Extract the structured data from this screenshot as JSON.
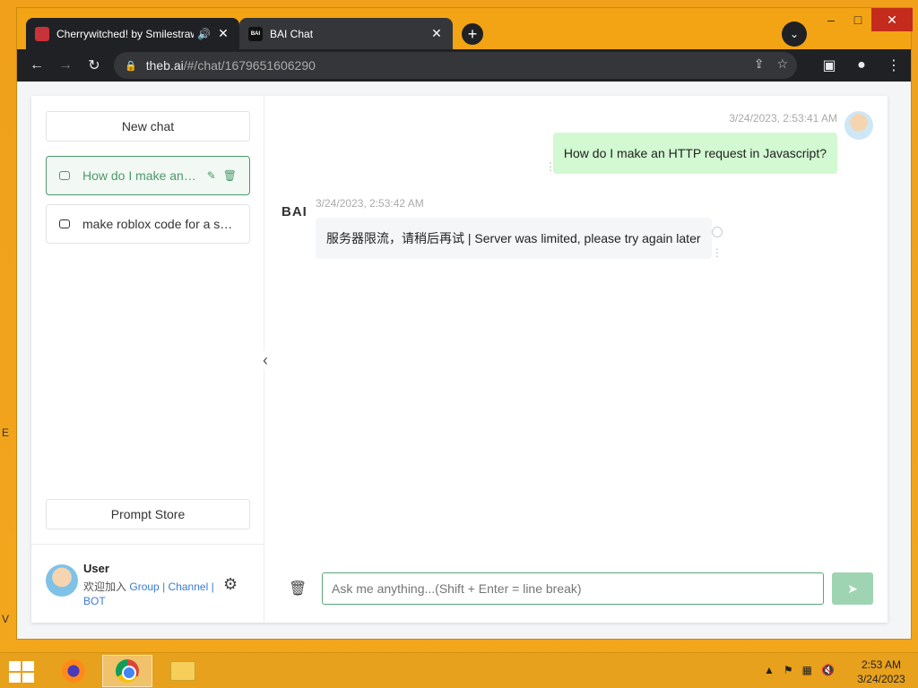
{
  "browser": {
    "tabs": [
      {
        "title": "Cherrywitched! by Smilestraw",
        "audio_icon": "speaker-icon",
        "close": "✕"
      },
      {
        "title": "BAI Chat",
        "favicon_text": "BAI",
        "close": "✕"
      }
    ],
    "new_tab": "+",
    "tab_search": "⌄",
    "window": {
      "minimize": "–",
      "maximize": "□",
      "close": "✕"
    },
    "nav": {
      "back": "←",
      "forward": "→",
      "reload": "↻"
    },
    "url_host": "theb.ai",
    "url_path": "/#/chat/1679651606290",
    "omni_icons": {
      "share": "⇪",
      "star": "☆"
    },
    "right_tools": {
      "sidebar": "▣",
      "profile": "●",
      "menu": "⋮"
    }
  },
  "sidebar": {
    "new_chat": "New chat",
    "conversations": [
      {
        "title": "How do I make an HTTP request in Javascript?",
        "edit": "✎",
        "delete": "🗑"
      },
      {
        "title": "make roblox code for a spinning part"
      }
    ],
    "prompt_store": "Prompt Store",
    "user": {
      "name": "User",
      "welcome": "欢迎加入",
      "links": [
        "Group",
        "Channel",
        "BOT"
      ],
      "sep": "|",
      "settings_icon": "⚙"
    },
    "collapse": "‹"
  },
  "chat": {
    "messages": [
      {
        "role": "user",
        "time": "3/24/2023, 2:53:41 AM",
        "text": "How do I make an HTTP request in Javascript?"
      },
      {
        "role": "bot",
        "time": "3/24/2023, 2:53:42 AM",
        "text": "服务器限流，请稍后再试 | Server was limited, please try again later"
      }
    ],
    "bot_logo": "BAI",
    "more_dots": "⋮",
    "input_placeholder": "Ask me anything...(Shift + Enter = line break)",
    "clear_icon": "🗑",
    "send_icon": "➤"
  },
  "taskbar": {
    "time": "2:53 AM",
    "date": "3/24/2023",
    "tray": [
      "▲",
      "⚑",
      "▦",
      "🔇"
    ]
  },
  "desktop": {
    "edge_letters": [
      "E",
      "V"
    ]
  }
}
